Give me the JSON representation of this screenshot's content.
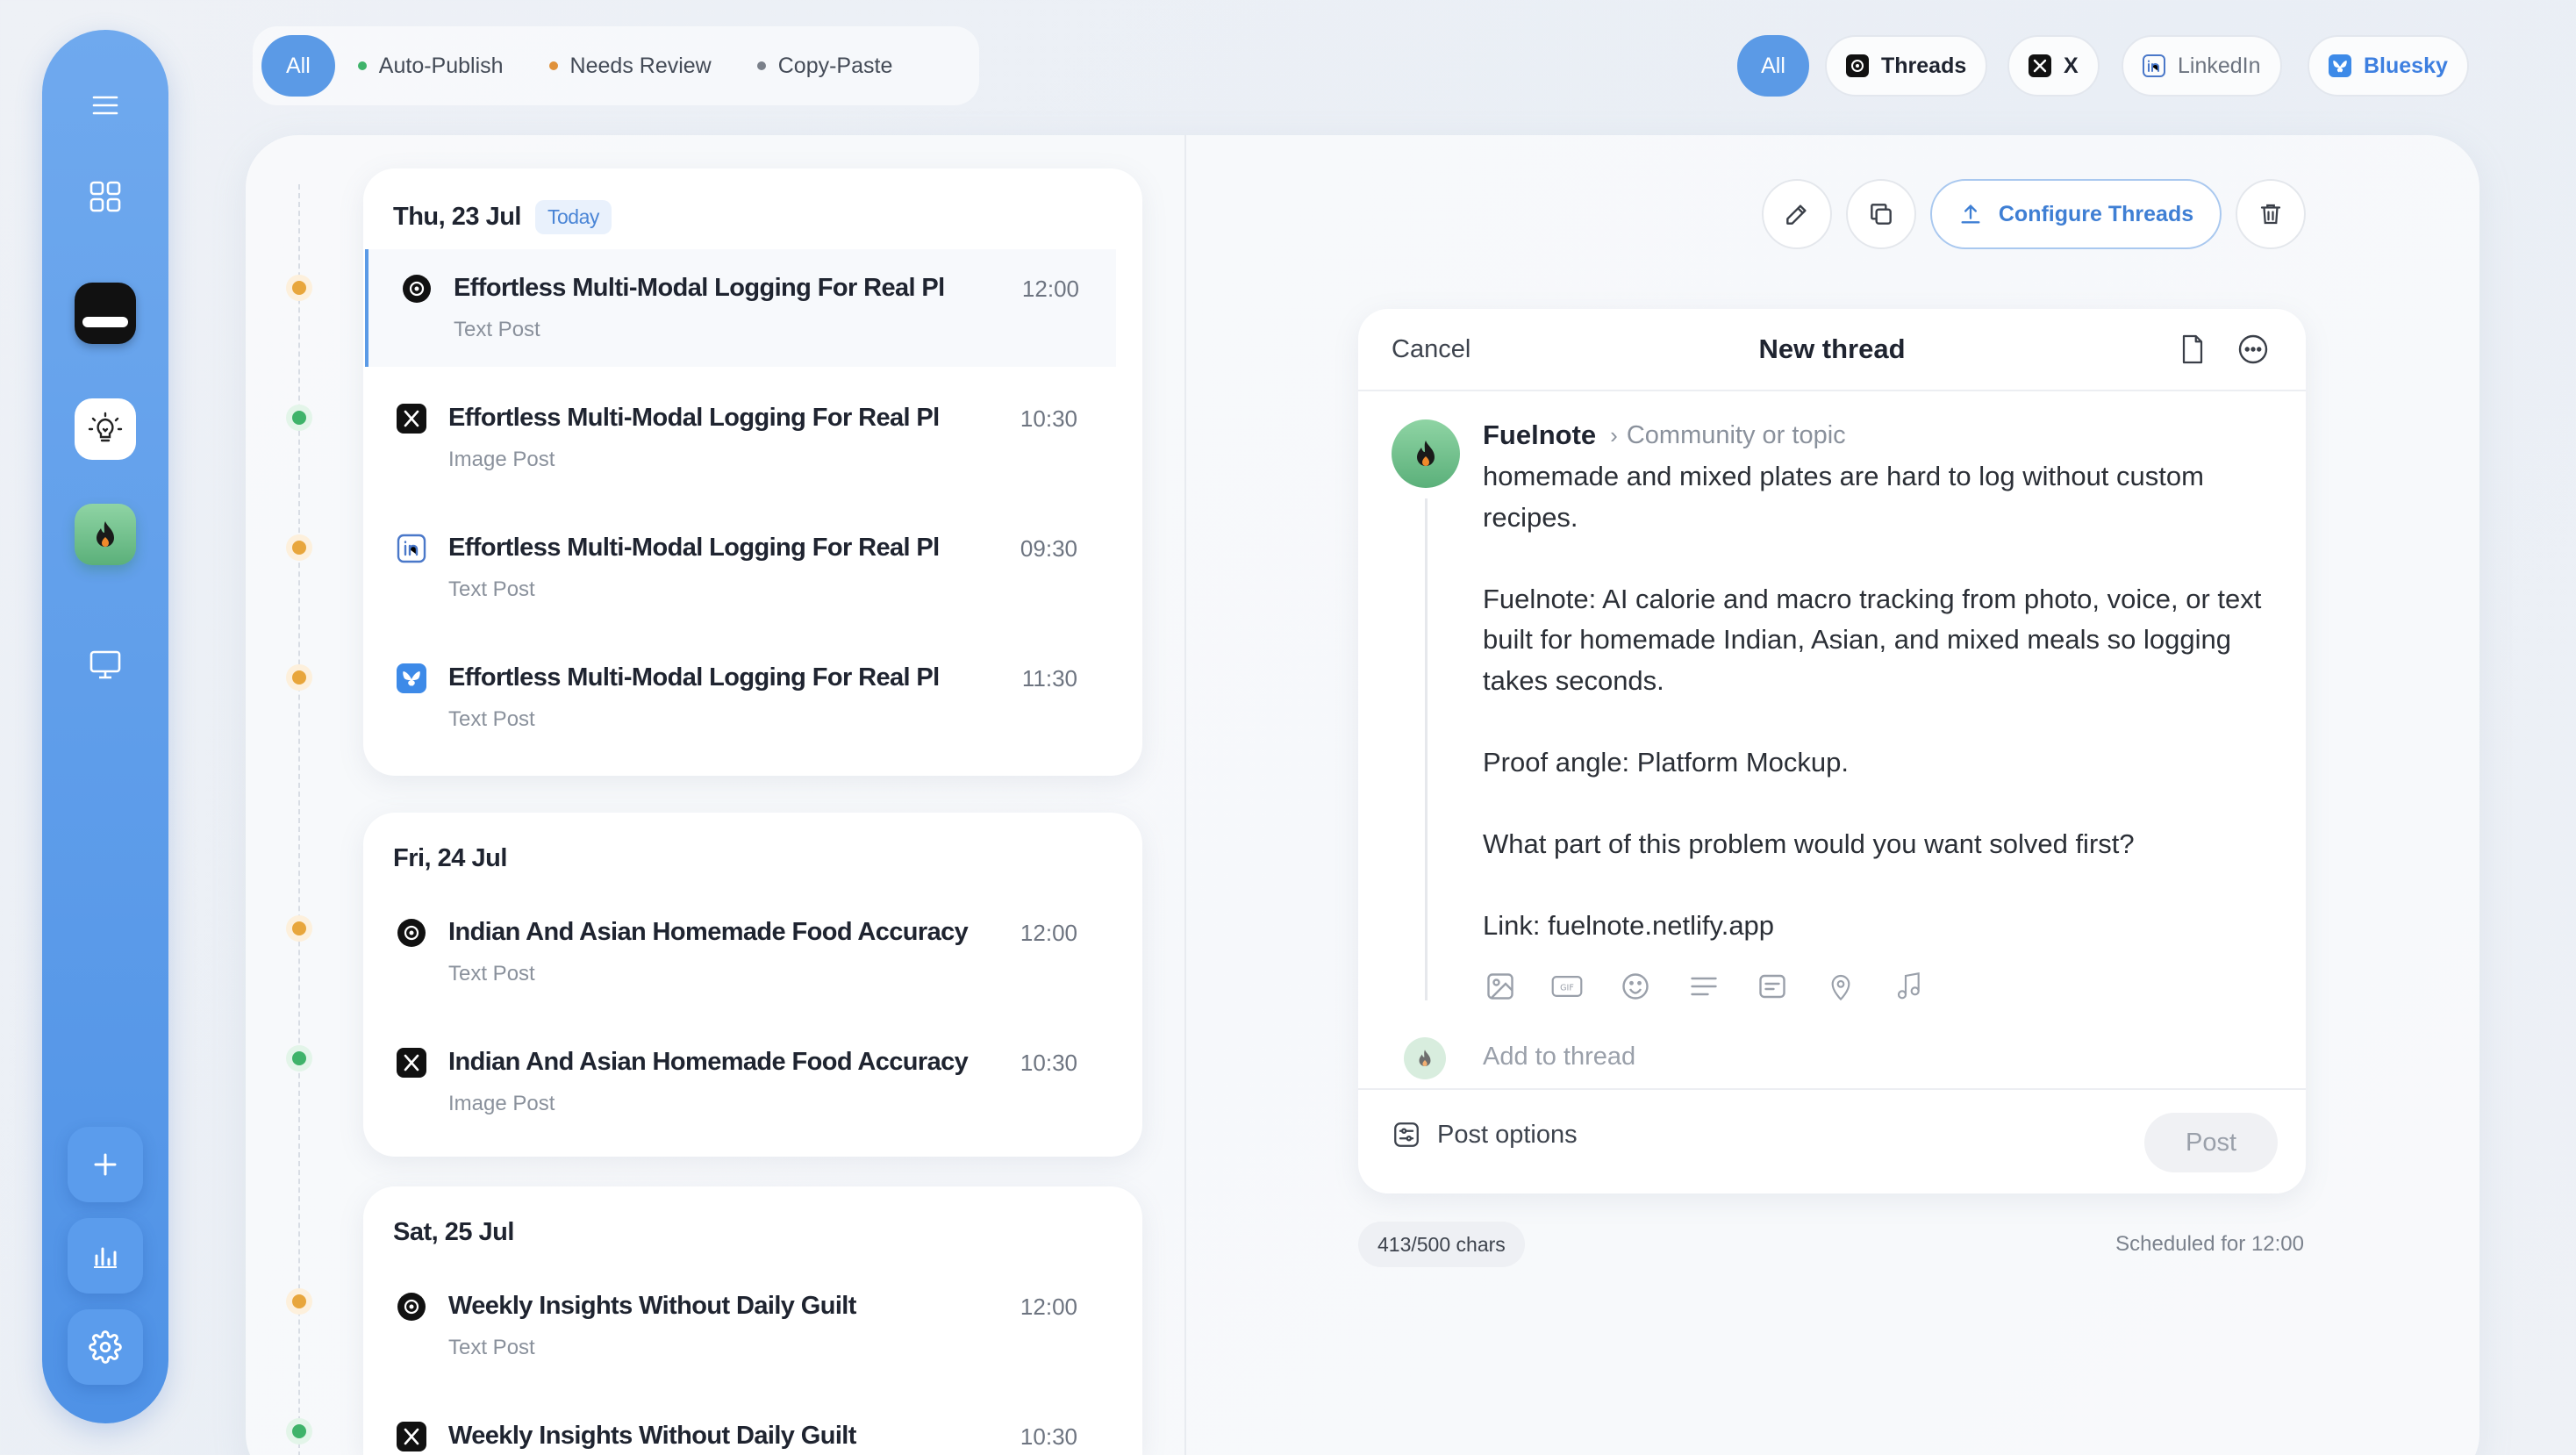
{
  "sidebar": {
    "items": [
      {
        "name": "menu-icon"
      },
      {
        "name": "grid-icon"
      },
      {
        "name": "app-icon-dark"
      },
      {
        "name": "app-icon-lightbulb"
      },
      {
        "name": "app-icon-fuelnote"
      },
      {
        "name": "monitor-icon"
      }
    ],
    "bottom": [
      "plus-icon",
      "chart-icon",
      "gear-icon"
    ]
  },
  "status_filters": [
    {
      "label": "All",
      "active": true
    },
    {
      "label": "Auto-Publish",
      "dot": "#3fb36a"
    },
    {
      "label": "Needs Review",
      "dot": "#e0913a"
    },
    {
      "label": "Copy-Paste",
      "dot": "#7a808a"
    }
  ],
  "platform_filters": {
    "all": "All",
    "threads": "Threads",
    "x": "X",
    "linkedin": "LinkedIn",
    "bluesky": "Bluesky"
  },
  "schedule": {
    "days": [
      {
        "date": "Thu, 23 Jul",
        "badge": "Today",
        "posts": [
          {
            "platform": "threads",
            "title": "Effortless Multi-Modal Logging For Real Pl",
            "type": "Text Post",
            "time": "12:00",
            "status": "review",
            "selected": true
          },
          {
            "platform": "x",
            "title": "Effortless Multi-Modal Logging For Real Pl",
            "type": "Image Post",
            "time": "10:30",
            "status": "auto"
          },
          {
            "platform": "linkedin",
            "title": "Effortless Multi-Modal Logging For Real Pl",
            "type": "Text Post",
            "time": "09:30",
            "status": "review"
          },
          {
            "platform": "bluesky",
            "title": "Effortless Multi-Modal Logging For Real Pl",
            "type": "Text Post",
            "time": "11:30",
            "status": "review"
          }
        ]
      },
      {
        "date": "Fri, 24 Jul",
        "posts": [
          {
            "platform": "threads",
            "title": "Indian And Asian Homemade Food Accuracy",
            "type": "Text Post",
            "time": "12:00",
            "status": "review"
          },
          {
            "platform": "x",
            "title": "Indian And Asian Homemade Food Accuracy",
            "type": "Image Post",
            "time": "10:30",
            "status": "auto"
          }
        ]
      },
      {
        "date": "Sat, 25 Jul",
        "posts": [
          {
            "platform": "threads",
            "title": "Weekly Insights Without Daily Guilt",
            "type": "Text Post",
            "time": "12:00",
            "status": "review"
          },
          {
            "platform": "x",
            "title": "Weekly Insights Without Daily Guilt",
            "type": "Image Post",
            "time": "10:30",
            "status": "auto"
          }
        ]
      }
    ]
  },
  "toolbar": {
    "configure_label": "Configure Threads"
  },
  "composer": {
    "cancel": "Cancel",
    "title": "New thread",
    "account": "Fuelnote",
    "topic": "Community or topic",
    "body": "homemade and mixed plates are hard to log without custom recipes.\n\nFuelnote: AI calorie and macro tracking from photo, voice, or text built for homemade Indian, Asian, and mixed meals so logging takes seconds.\n\nProof angle: Platform Mockup.\n\nWhat part of this problem would you want solved first?\n\nLink: fuelnote.netlify.app",
    "add_to_thread": "Add to thread",
    "post_options": "Post options",
    "post": "Post"
  },
  "footer": {
    "chars": "413/500 chars",
    "scheduled": "Scheduled for 12:00"
  },
  "colors": {
    "accent": "#5b9ae6",
    "auto": "#3fb36a",
    "review": "#e8a63c",
    "linkedin": "#4a78c9",
    "bluesky": "#3d8ae8"
  }
}
